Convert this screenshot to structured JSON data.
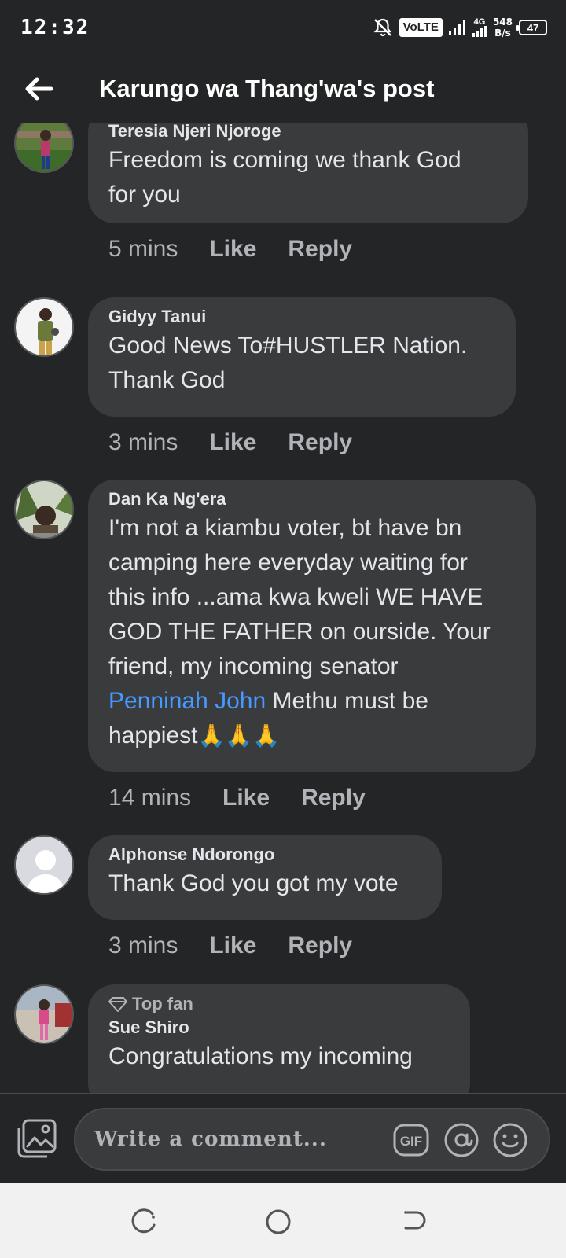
{
  "status_bar": {
    "time": "12:32",
    "volte": "VoLTE",
    "network_gen": "4G",
    "net_speed_value": "548",
    "net_speed_unit": "B/s",
    "battery": "47"
  },
  "header": {
    "title": "Karungo wa Thang'wa's post"
  },
  "comments": [
    {
      "author": "Teresia Njeri Njoroge",
      "lines": [
        "Freedom is coming  we thank  God",
        "for you"
      ],
      "time": "5 mins",
      "like": "Like",
      "reply": "Reply"
    },
    {
      "author": "Gidyy Tanui",
      "lines": [
        "Good News To#HUSTLER Nation.",
        "Thank God"
      ],
      "time": "3 mins",
      "like": "Like",
      "reply": "Reply"
    },
    {
      "author": "Dan Ka Ng'era",
      "lines": [
        "I'm not a kiambu voter, bt have bn",
        "camping here everyday waiting for",
        "this info ...ama kwa kweli WE HAVE",
        "GOD THE FATHER on ourside. Your",
        "friend,  my incoming senator"
      ],
      "mention": "Penninah John",
      "after_mention": " Methu must be",
      "last_line": "happiest",
      "emoji": "🙏🙏🙏",
      "time": "14 mins",
      "like": "Like",
      "reply": "Reply"
    },
    {
      "author": "Alphonse Ndorongo",
      "lines": [
        "Thank God you got my vote"
      ],
      "time": "3 mins",
      "like": "Like",
      "reply": "Reply"
    },
    {
      "badge": "Top fan",
      "author": "Sue Shiro",
      "lines": [
        "Congratulations my incoming"
      ]
    }
  ],
  "composer": {
    "placeholder": "Write a comment...",
    "gif_label": "GIF"
  }
}
